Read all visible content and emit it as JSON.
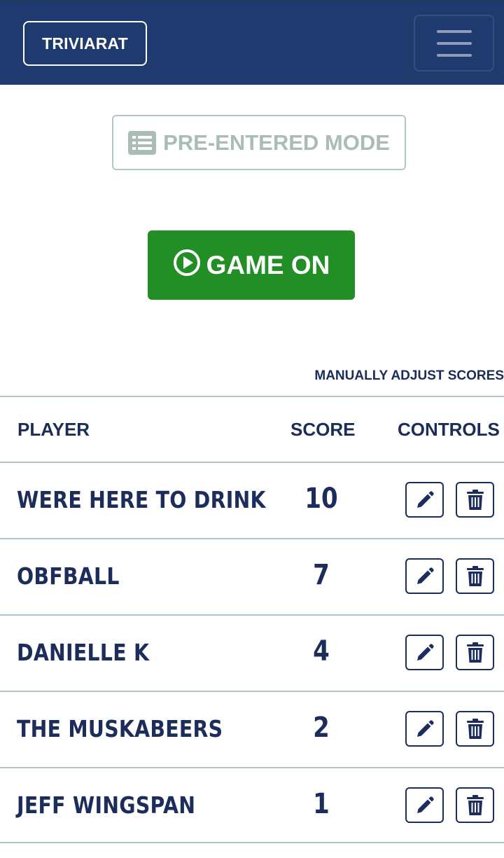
{
  "navbar": {
    "brand": "TRIVIARAT",
    "menu_icon": "hamburger-menu-icon"
  },
  "mode_button": {
    "label": "PRE-ENTERED MODE",
    "icon": "list-icon"
  },
  "game_button": {
    "label": "GAME ON",
    "icon": "play-circle-icon"
  },
  "manual_adjust_label": "MANUALLY ADJUST SCORES",
  "table": {
    "headers": {
      "player": "PLAYER",
      "score": "SCORE",
      "controls": "CONTROLS"
    },
    "rows": [
      {
        "player": "WERE HERE TO DRINK",
        "score": "10"
      },
      {
        "player": "OBFBALL",
        "score": "7"
      },
      {
        "player": "DANIELLE K",
        "score": "4"
      },
      {
        "player": "THE MUSKABEERS",
        "score": "2"
      },
      {
        "player": "JEFF WINGSPAN",
        "score": "1"
      }
    ],
    "row_control_icons": [
      "pencil-icon",
      "trash-icon"
    ]
  },
  "colors": {
    "navbar": "#1e3a6e",
    "game_button": "#218f25",
    "text_dark": "#1c2d5c",
    "mode_button_text": "#a9bcb7"
  }
}
